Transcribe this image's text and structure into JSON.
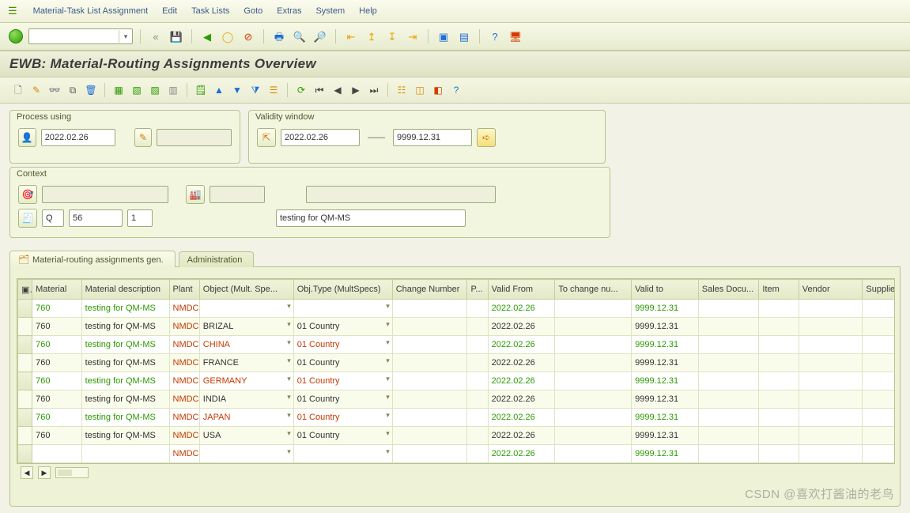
{
  "menu": {
    "items": [
      "Material-Task List Assignment",
      "Edit",
      "Task Lists",
      "Goto",
      "Extras",
      "System",
      "Help"
    ]
  },
  "title": "EWB: Material-Routing Assignments Overview",
  "process": {
    "legend": "Process using",
    "date": "2022.02.26"
  },
  "validity": {
    "legend": "Validity window",
    "from": "2022.02.26",
    "to": "9999.12.31",
    "sep": "——"
  },
  "context": {
    "legend": "Context",
    "type": "Q",
    "group": "56",
    "counter": "1",
    "desc": "testing for QM-MS"
  },
  "tabs": {
    "t1": "Material-routing assignments gen.",
    "t2": "Administration"
  },
  "grid": {
    "headers": [
      "Material",
      "Material description",
      "Plant",
      "Object (Mult. Spe...",
      "Obj.Type (MultSpecs)",
      "Change Number",
      "P...",
      "Valid From",
      "To change nu...",
      "Valid to",
      "Sales Docu...",
      "Item",
      "Vendor",
      "Supplie"
    ],
    "rows": [
      {
        "green": true,
        "material": "760",
        "desc": "testing for QM-MS",
        "plant": "NMDC",
        "object": "",
        "objtype": "",
        "cn": "",
        "p": "",
        "vf": "2022.02.26",
        "tcn": "",
        "vt": "9999.12.31"
      },
      {
        "green": false,
        "material": "760",
        "desc": "testing for QM-MS",
        "plant": "NMDC",
        "object": "BRIZAL",
        "objtype": "01 Country",
        "cn": "",
        "p": "",
        "vf": "2022.02.26",
        "tcn": "",
        "vt": "9999.12.31"
      },
      {
        "green": true,
        "material": "760",
        "desc": "testing for QM-MS",
        "plant": "NMDC",
        "object": "CHINA",
        "objtype": "01 Country",
        "cn": "",
        "p": "",
        "vf": "2022.02.26",
        "tcn": "",
        "vt": "9999.12.31"
      },
      {
        "green": false,
        "material": "760",
        "desc": "testing for QM-MS",
        "plant": "NMDC",
        "object": "FRANCE",
        "objtype": "01 Country",
        "cn": "",
        "p": "",
        "vf": "2022.02.26",
        "tcn": "",
        "vt": "9999.12.31"
      },
      {
        "green": true,
        "material": "760",
        "desc": "testing for QM-MS",
        "plant": "NMDC",
        "object": "GERMANY",
        "objtype": "01 Country",
        "cn": "",
        "p": "",
        "vf": "2022.02.26",
        "tcn": "",
        "vt": "9999.12.31"
      },
      {
        "green": false,
        "material": "760",
        "desc": "testing for QM-MS",
        "plant": "NMDC",
        "object": "INDIA",
        "objtype": "01 Country",
        "cn": "",
        "p": "",
        "vf": "2022.02.26",
        "tcn": "",
        "vt": "9999.12.31"
      },
      {
        "green": true,
        "material": "760",
        "desc": "testing for QM-MS",
        "plant": "NMDC",
        "object": "JAPAN",
        "objtype": "01 Country",
        "cn": "",
        "p": "",
        "vf": "2022.02.26",
        "tcn": "",
        "vt": "9999.12.31"
      },
      {
        "green": false,
        "material": "760",
        "desc": "testing for QM-MS",
        "plant": "NMDC",
        "object": "USA",
        "objtype": "01 Country",
        "cn": "",
        "p": "",
        "vf": "2022.02.26",
        "tcn": "",
        "vt": "9999.12.31"
      },
      {
        "green": true,
        "material": "",
        "desc": "",
        "plant": "NMDC",
        "object": "",
        "objtype": "",
        "cn": "",
        "p": "",
        "vf": "2022.02.26",
        "tcn": "",
        "vt": "9999.12.31"
      }
    ]
  },
  "watermark": "CSDN @喜欢打酱油的老鸟"
}
